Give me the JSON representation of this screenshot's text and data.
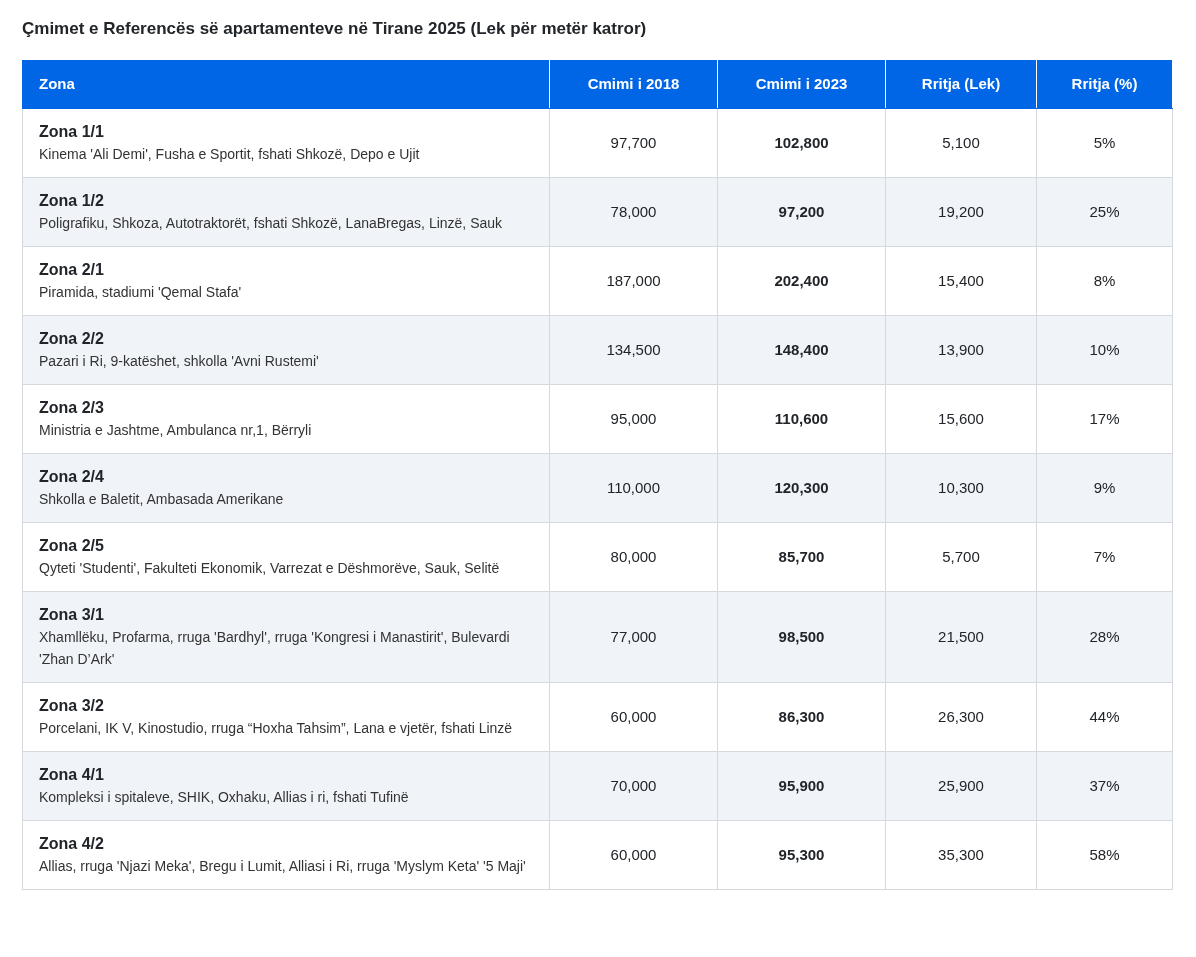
{
  "title": "Çmimet e Referencës së apartamenteve në Tirane 2025 (Lek për metër katror)",
  "table": {
    "columns": [
      "Zona",
      "Cmimi i 2018",
      "Cmimi i 2023",
      "Rritja (Lek)",
      "Rritja (%)"
    ],
    "rows": [
      {
        "zone": "Zona 1/1",
        "areas": "Kinema 'Ali Demi', Fusha e Sportit, fshati Shkozë, Depo e Ujit",
        "price_2018": "97,700",
        "price_2023": "102,800",
        "growth_lek": "5,100",
        "growth_pct": "5%"
      },
      {
        "zone": "Zona 1/2",
        "areas": "Poligrafiku, Shkoza, Autotraktorët, fshati Shkozë, LanaBregas, Linzë, Sauk",
        "price_2018": "78,000",
        "price_2023": "97,200",
        "growth_lek": "19,200",
        "growth_pct": "25%"
      },
      {
        "zone": "Zona 2/1",
        "areas": "Piramida, stadiumi 'Qemal Stafa'",
        "price_2018": "187,000",
        "price_2023": "202,400",
        "growth_lek": "15,400",
        "growth_pct": "8%"
      },
      {
        "zone": "Zona 2/2",
        "areas": "Pazari i Ri, 9-katëshet, shkolla 'Avni Rustemi'",
        "price_2018": "134,500",
        "price_2023": "148,400",
        "growth_lek": "13,900",
        "growth_pct": "10%"
      },
      {
        "zone": "Zona 2/3",
        "areas": "Ministria e Jashtme, Ambulanca nr,1, Bërryli",
        "price_2018": "95,000",
        "price_2023": "110,600",
        "growth_lek": "15,600",
        "growth_pct": "17%"
      },
      {
        "zone": "Zona 2/4",
        "areas": "Shkolla e Baletit, Ambasada Amerikane",
        "price_2018": "110,000",
        "price_2023": "120,300",
        "growth_lek": "10,300",
        "growth_pct": "9%"
      },
      {
        "zone": "Zona 2/5",
        "areas": "Qyteti 'Studenti', Fakulteti Ekonomik, Varrezat e Dëshmorëve, Sauk, Selitë",
        "price_2018": "80,000",
        "price_2023": "85,700",
        "growth_lek": "5,700",
        "growth_pct": "7%"
      },
      {
        "zone": "Zona 3/1",
        "areas": "Xhamllëku, Profarma, rruga 'Bardhyl', rruga 'Kongresi i Manastirit', Bulevardi 'Zhan D’Ark'",
        "price_2018": "77,000",
        "price_2023": "98,500",
        "growth_lek": "21,500",
        "growth_pct": "28%"
      },
      {
        "zone": "Zona 3/2",
        "areas": "Porcelani, IK V, Kinostudio, rruga “Hoxha Tahsim”, Lana e vjetër, fshati Linzë",
        "price_2018": "60,000",
        "price_2023": "86,300",
        "growth_lek": "26,300",
        "growth_pct": "44%"
      },
      {
        "zone": "Zona 4/1",
        "areas": "Kompleksi i spitaleve, SHIK, Oxhaku, Allias i ri, fshati Tufinë",
        "price_2018": "70,000",
        "price_2023": "95,900",
        "growth_lek": "25,900",
        "growth_pct": "37%"
      },
      {
        "zone": "Zona 4/2",
        "areas": "Allias, rruga 'Njazi Meka', Bregu i Lumit, Alliasi i Ri, rruga 'Myslym Keta' '5 Maji'",
        "price_2018": "60,000",
        "price_2023": "95,300",
        "growth_lek": "35,300",
        "growth_pct": "58%"
      }
    ]
  }
}
